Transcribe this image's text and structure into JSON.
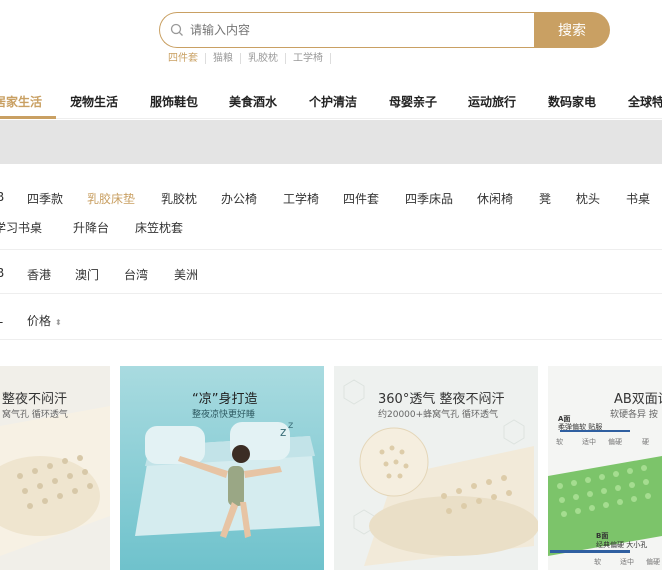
{
  "search": {
    "placeholder": "请输入内容",
    "button_label": "搜索"
  },
  "hot_words": [
    "四件套",
    "猫粮",
    "乳胶枕",
    "工学椅"
  ],
  "categories": [
    "居家生活",
    "宠物生活",
    "服饰鞋包",
    "美食酒水",
    "个护清洁",
    "母婴亲子",
    "运动旅行",
    "数码家电",
    "全球特色"
  ],
  "filters": {
    "row1": [
      "B",
      "四季款",
      "乳胶床垫",
      "乳胶枕",
      "办公椅",
      "工学椅",
      "四件套",
      "四季床品",
      "休闲椅",
      "凳",
      "枕头",
      "书桌"
    ],
    "row1b": [
      "学习书桌",
      "升降台",
      "床笠枕套"
    ],
    "row2": [
      "B",
      "香港",
      "澳门",
      "台湾",
      "美洲"
    ],
    "row3": [
      "L",
      "价格"
    ],
    "active": "乳胶床垫"
  },
  "products": [
    {
      "title": "整夜不闷汗",
      "subtitle": "窝气孔 循环透气",
      "prefix": "."
    },
    {
      "title": "“凉”身打造",
      "subtitle": "整夜凉快更好睡"
    },
    {
      "title": "360°透气 整夜不闷汗",
      "subtitle": "约20000+蜂窝气孔 循环透气"
    },
    {
      "title": "AB双面设",
      "subtitle": "软硬各异 按",
      "label_a": "A面",
      "label_a_sub": "柔弹偏软 贴服",
      "scale_a": [
        "软",
        "适中",
        "偏硬",
        "硬"
      ],
      "label_b": "B面",
      "label_b_sub": "经典偏硬 大小孔",
      "scale_b": [
        "软",
        "适中",
        "偏硬"
      ]
    }
  ],
  "colors": {
    "accent": "#c9a063",
    "banner": "#e4e4e4"
  }
}
